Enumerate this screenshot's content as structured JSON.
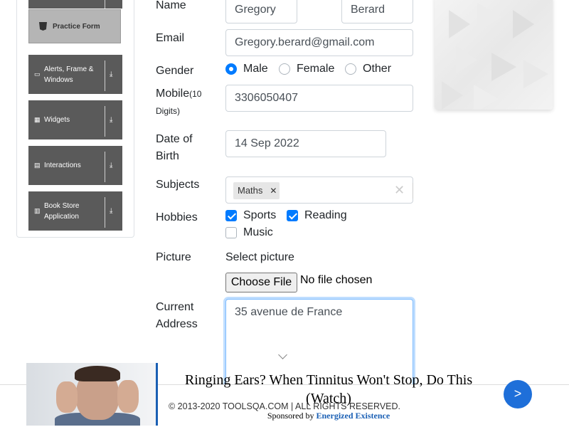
{
  "sidebar": {
    "practice_form": "Practice Form",
    "items": [
      {
        "label": "Alerts, Frame & Windows",
        "icon": "window-icon"
      },
      {
        "label": "Widgets",
        "icon": "widgets-icon"
      },
      {
        "label": "Interactions",
        "icon": "interactions-icon"
      },
      {
        "label": "Book Store Application",
        "icon": "book-icon"
      }
    ]
  },
  "form": {
    "name_label": "Name",
    "first_name": "Gregory",
    "last_name": "Berard",
    "email_label": "Email",
    "email": "Gregory.berard@gmail.com",
    "gender_label": "Gender",
    "gender_options": [
      "Male",
      "Female",
      "Other"
    ],
    "gender_selected": "Male",
    "mobile_label": "Mobile",
    "mobile_hint": "(10 Digits)",
    "mobile": "3306050407",
    "dob_label_1": "Date of",
    "dob_label_2": "Birth",
    "dob": "14 Sep 2022",
    "subjects_label": "Subjects",
    "subjects": [
      "Maths"
    ],
    "hobbies_label": "Hobbies",
    "hobbies": [
      {
        "label": "Sports",
        "checked": true
      },
      {
        "label": "Reading",
        "checked": true
      },
      {
        "label": "Music",
        "checked": false
      }
    ],
    "picture_label": "Picture",
    "picture_hint": "Select picture",
    "choose_file": "Choose File",
    "file_status": "No file chosen",
    "address_label_1": "Current",
    "address_label_2": "Address",
    "address": "35 avenue de France"
  },
  "footer": {
    "copyright": "© 2013-2020 TOOLSQA.COM | ALL RIGHTS RESERVED."
  },
  "ad": {
    "headline": "Ringing Ears? When Tinnitus Won't Stop, Do This (Watch)",
    "sponsor_prefix": "Sponsored by",
    "sponsor": "Energized Existence",
    "next": ">"
  },
  "colors": {
    "accent": "#007bff",
    "sidebar_card": "#5a5a5a",
    "ad_button": "#1e6fd9"
  }
}
